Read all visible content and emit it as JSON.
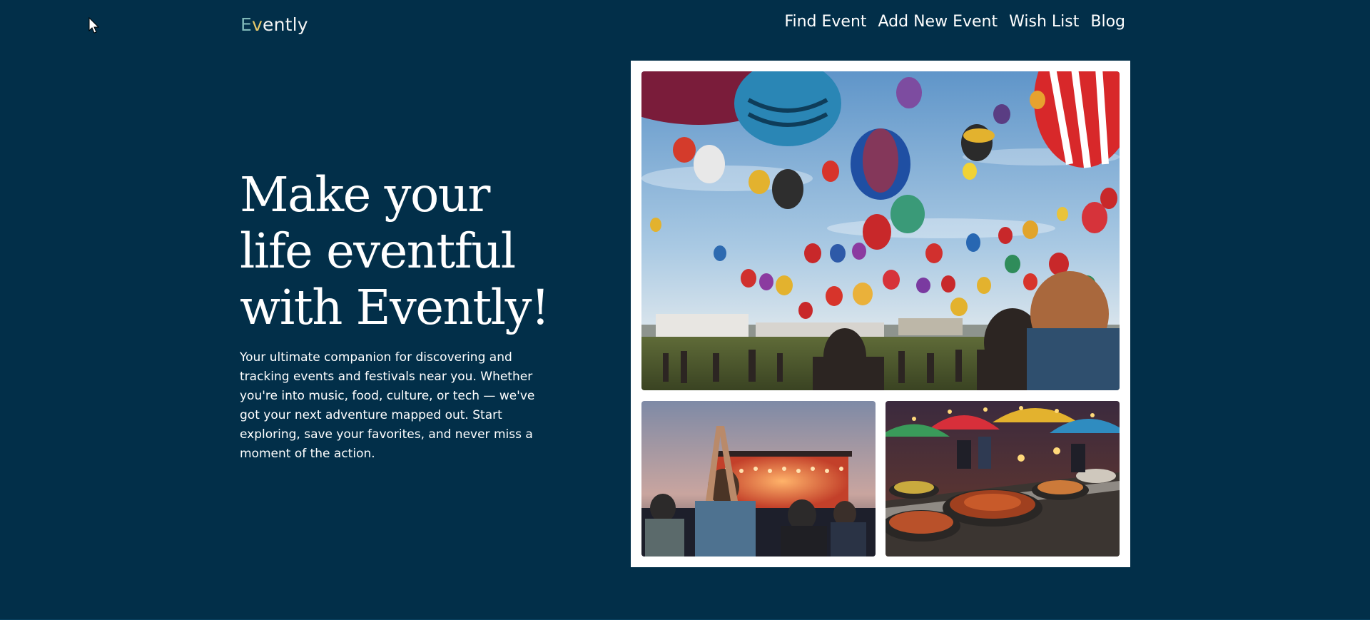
{
  "header": {
    "logo": {
      "part1": "E",
      "part2": "v",
      "part3": "ently"
    },
    "nav": [
      {
        "label": "Find Event"
      },
      {
        "label": "Add New Event"
      },
      {
        "label": "Wish List"
      },
      {
        "label": "Blog"
      }
    ]
  },
  "hero": {
    "title": "Make your life eventful with Evently!",
    "description": "Your ultimate companion for discovering and tracking events and festivals near you. Whether you're into music, food, culture, or tech — we've got your next adventure mapped out. Start exploring, save your favorites, and never miss a moment of the action."
  },
  "colors": {
    "background": "#022f49",
    "text": "#ffffff",
    "frame": "#ffffff"
  },
  "images": {
    "main": "hot-air-balloon-festival-photo",
    "secondary": [
      "concert-crowd-photo",
      "street-food-market-photo"
    ]
  }
}
